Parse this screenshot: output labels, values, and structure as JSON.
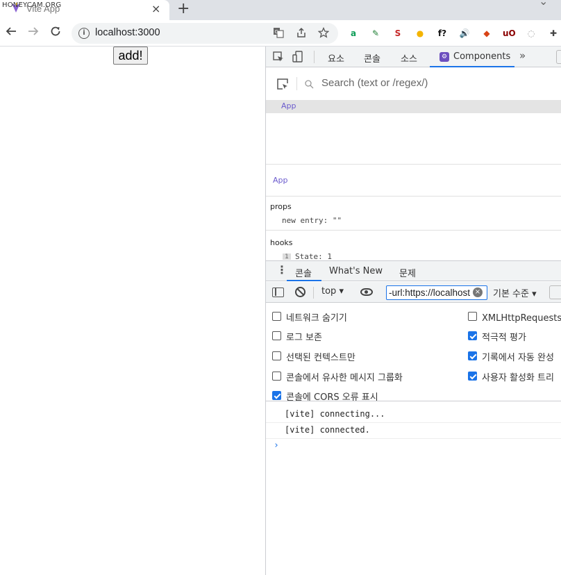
{
  "browser": {
    "watermark": "HONEYCAM.ORG",
    "tab_title": "Vite App",
    "tab_close": "×",
    "new_tab": "+",
    "url": "localhost:3000",
    "info_glyph": "i",
    "extensions": [
      {
        "name": "amazon-assistant-icon",
        "glyph": "a",
        "color": "#0f9d58"
      },
      {
        "name": "eyedropper-icon",
        "glyph": "✎",
        "color": "#1e7e34"
      },
      {
        "name": "s-extension-icon",
        "glyph": "S",
        "color": "#c62828"
      },
      {
        "name": "fruit-extension-icon",
        "glyph": "●",
        "color": "#f4b400"
      },
      {
        "name": "font-identifier-icon",
        "glyph": "f?",
        "color": "#111111"
      },
      {
        "name": "speaker-icon",
        "glyph": "🔊",
        "color": "#222222"
      },
      {
        "name": "fox-extension-icon",
        "glyph": "◆",
        "color": "#d84315"
      },
      {
        "name": "ublock-origin-icon",
        "glyph": "uO",
        "color": "#8b0000"
      },
      {
        "name": "circle-extension-icon",
        "glyph": "◌",
        "color": "#999999"
      },
      {
        "name": "puzzle-extensions-icon",
        "glyph": "✚",
        "color": "#444444"
      }
    ]
  },
  "page": {
    "add_button": "add!"
  },
  "devtools": {
    "tabs": [
      "요소",
      "콘솔",
      "소스"
    ],
    "active_tab": "Components",
    "more": "»",
    "components": {
      "search_placeholder": "Search (text or /regex/)",
      "tree_root": "App",
      "inspected": "App",
      "props_label": "props",
      "props_entry_key": "new entry",
      "props_entry_value": "\"\"",
      "hooks_label": "hooks",
      "hooks_badge": "1",
      "hooks_state": "State: 1"
    },
    "drawer": {
      "tabs": [
        "콘솔",
        "What's New",
        "문제"
      ],
      "context": "top",
      "filter_value": "-url:https://localhost",
      "level": "기본 수준",
      "settings_left": [
        {
          "label": "네트워크 숨기기",
          "checked": false
        },
        {
          "label": "로그 보존",
          "checked": false
        },
        {
          "label": "선택된 컨텍스트만",
          "checked": false
        },
        {
          "label": "콘솔에서 유사한 메시지 그룹화",
          "checked": false
        },
        {
          "label": "콘솔에 CORS 오류 표시",
          "checked": true
        }
      ],
      "settings_right": [
        {
          "label": "XMLHttpRequests 로",
          "checked": false
        },
        {
          "label": "적극적 평가",
          "checked": true
        },
        {
          "label": "기록에서 자동 완성",
          "checked": true
        },
        {
          "label": "사용자 활성화 트리",
          "checked": true
        }
      ],
      "logs": [
        "[vite] connecting...",
        "[vite] connected."
      ],
      "prompt": "›"
    }
  }
}
